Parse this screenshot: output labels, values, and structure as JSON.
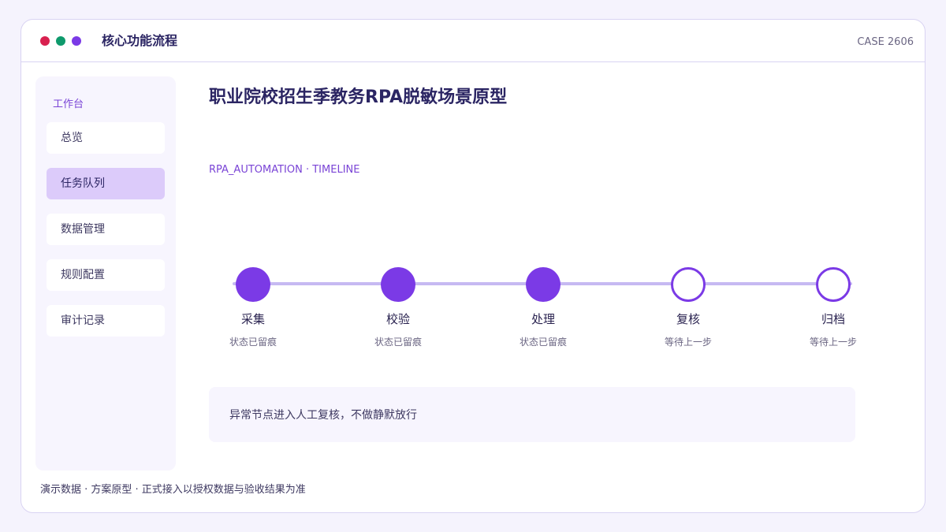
{
  "window": {
    "app_title": "核心功能流程",
    "case_label": "CASE 2606",
    "traffic_lights": [
      {
        "name": "red-dot",
        "color": "#d8204f"
      },
      {
        "name": "green-dot",
        "color": "#0e9a6c"
      },
      {
        "name": "purple-dot",
        "color": "#7b3ae6"
      }
    ]
  },
  "sidebar": {
    "heading": "工作台",
    "items": [
      {
        "label": "总览",
        "active": false
      },
      {
        "label": "任务队列",
        "active": true
      },
      {
        "label": "数据管理",
        "active": false
      },
      {
        "label": "规则配置",
        "active": false
      },
      {
        "label": "审计记录",
        "active": false
      }
    ]
  },
  "main": {
    "title": "职业院校招生季教务RPA脱敏场景原型",
    "subtitle": "RPA_AUTOMATION · TIMELINE",
    "timeline": {
      "steps": [
        {
          "label": "采集",
          "status": "状态已留痕",
          "done": true
        },
        {
          "label": "校验",
          "status": "状态已留痕",
          "done": true
        },
        {
          "label": "处理",
          "status": "状态已留痕",
          "done": true
        },
        {
          "label": "复核",
          "status": "等待上一步",
          "done": false
        },
        {
          "label": "归档",
          "status": "等待上一步",
          "done": false
        }
      ]
    },
    "note": "异常节点进入人工复核，不做静默放行"
  },
  "footer": "演示数据 · 方案原型 · 正式接入以授权数据与验收结果为准",
  "colors": {
    "accent": "#7b3ae6",
    "accent_light": "#dccbfa",
    "track": "#c6b9f2",
    "text_dark": "#2b2563"
  }
}
